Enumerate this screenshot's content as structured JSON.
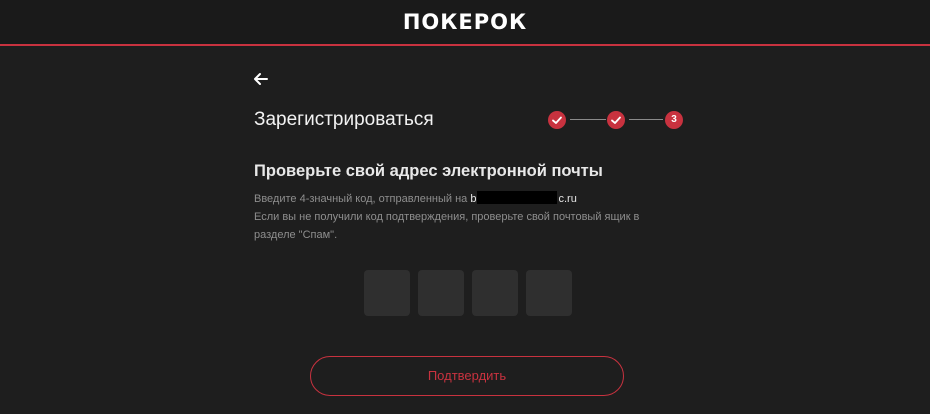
{
  "header": {
    "logo_text": "ПОКЕРОК"
  },
  "icons": {
    "back": "arrow-left-icon",
    "step_done": "checkmark-icon"
  },
  "colors": {
    "accent": "#c8323f",
    "background": "#1e1e1e",
    "code_box": "#2f2f2f"
  },
  "form": {
    "title": "Зарегистрироваться",
    "stepper": {
      "steps": [
        {
          "label": "✓",
          "status": "done"
        },
        {
          "label": "✓",
          "status": "done"
        },
        {
          "label": "3",
          "status": "current"
        }
      ]
    },
    "subtitle": "Проверьте свой адрес электронной почты",
    "instruction_prefix": "Введите 4-значный код, отправленный на",
    "email_visible_start": "b",
    "email_visible_end": "c.ru",
    "spam_hint": "Если вы не получили код подтверждения, проверьте свой почтовый ящик в разделе \"Спам\".",
    "code_digits": [
      "",
      "",
      "",
      ""
    ],
    "confirm_label": "Подтвердить"
  }
}
